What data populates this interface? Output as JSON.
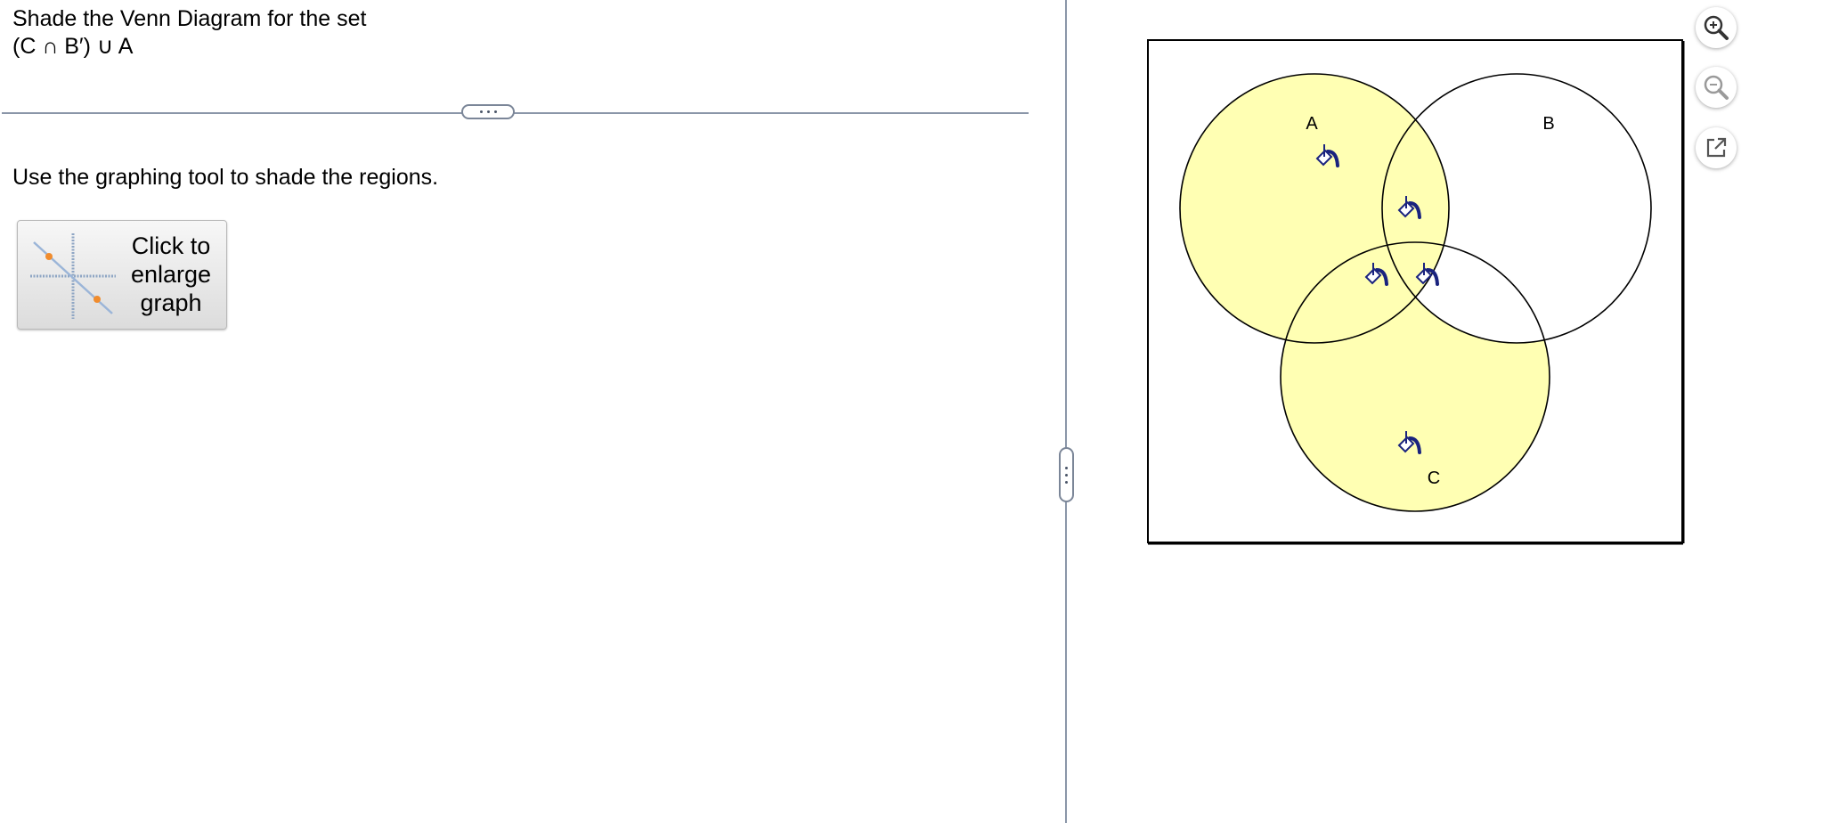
{
  "question": {
    "line1": "Shade the Venn Diagram for the set",
    "line2": "(C ∩ B′) ∪ A"
  },
  "instruction": "Use the graphing tool to shade the regions.",
  "enlarge_button": {
    "label": "Click to enlarge graph"
  },
  "venn": {
    "labels": {
      "a": "A",
      "b": "B",
      "c": "C"
    },
    "shade_color": "#ffffb3",
    "outline_color": "#000000",
    "icon_color": "#1a237e",
    "shaded_regions": [
      "A only",
      "A ∩ B only",
      "A ∩ C only",
      "A ∩ B ∩ C",
      "C only"
    ],
    "unshaded_regions": [
      "B only",
      "B ∩ C only",
      "outside"
    ]
  },
  "toolbar": {
    "zoom_in_icon": "zoom-in-icon",
    "zoom_out_icon": "zoom-out-icon",
    "popout_icon": "popout-icon"
  },
  "colors": {
    "divider": "#8a96a8",
    "zoom_in_active": "#333333",
    "zoom_out_disabled": "#9a9a9a"
  }
}
